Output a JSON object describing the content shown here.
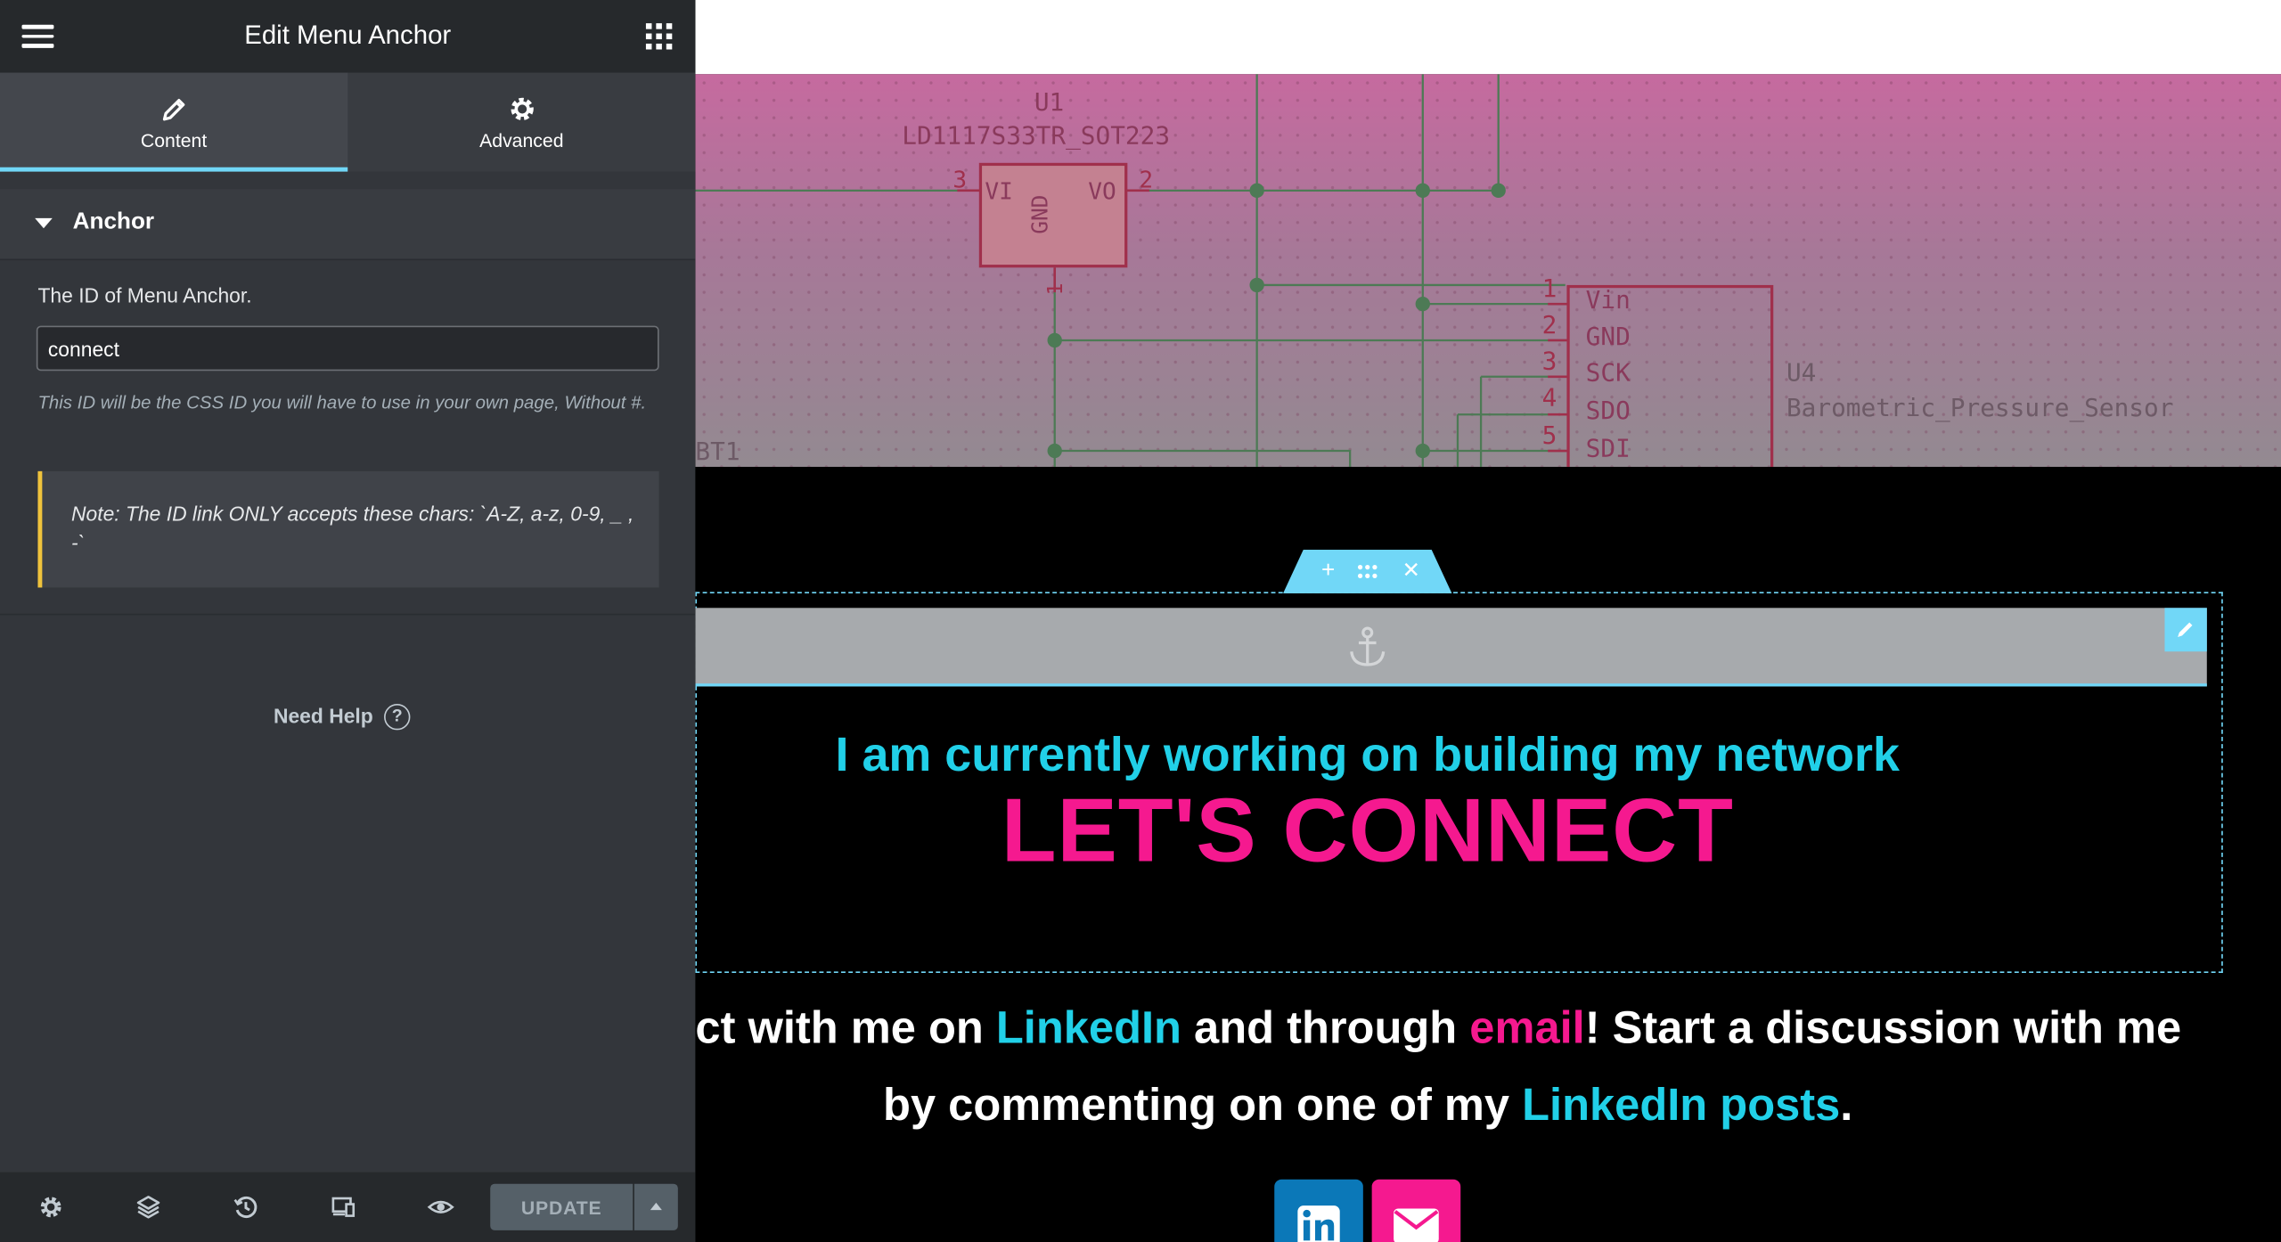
{
  "panel": {
    "title": "Edit Menu Anchor",
    "tabs": [
      {
        "label": "Content",
        "active": true
      },
      {
        "label": "Advanced",
        "active": false
      }
    ],
    "section": {
      "title": "Anchor"
    },
    "field": {
      "label": "The ID of Menu Anchor.",
      "value": "connect",
      "description": "This ID will be the CSS ID you will have to use in your own page, Without #."
    },
    "note": "Note: The ID link ONLY accepts these chars: `A-Z, a-z, 0-9, _ , -`",
    "help": "Need Help",
    "footer": {
      "update_label": "UPDATE"
    },
    "colors": {
      "accent": "#71d7f7",
      "note_border": "#f0c33c"
    }
  },
  "preview": {
    "schematic": {
      "u1_ref": "U1",
      "u1_part": "LD1117S33TR_SOT223",
      "u1_pin_vi": "VI",
      "u1_pin_vo": "VO",
      "u1_pin_gnd": "GND",
      "pin3": "3",
      "pin2": "2",
      "pin1": "1",
      "bt1": "BT1",
      "u4_ref": "U4",
      "u4_part": "Barometric_Pressure_Sensor",
      "u4_pins": [
        {
          "num": "1",
          "name": "Vin"
        },
        {
          "num": "2",
          "name": "GND"
        },
        {
          "num": "3",
          "name": "SCK"
        },
        {
          "num": "4",
          "name": "SDO"
        },
        {
          "num": "5",
          "name": "SDI"
        }
      ]
    },
    "subheading": "I am currently working on building my network",
    "heading": "LET'S CONNECT",
    "paragraph": {
      "l1_a": "ct with me on ",
      "l1_link1": "LinkedIn",
      "l1_b": " and through ",
      "l1_link2": "email",
      "l1_c": "! Start a discussion with me",
      "l2_a": "by commenting on one of my ",
      "l2_link": "LinkedIn posts",
      "l2_b": "."
    },
    "social": [
      {
        "icon": "linkedin-icon",
        "color": "#0b78b8"
      },
      {
        "icon": "envelope-icon",
        "color": "#f5198f"
      }
    ],
    "colors": {
      "cyan": "#21d0e8",
      "pink": "#f5198f"
    }
  }
}
